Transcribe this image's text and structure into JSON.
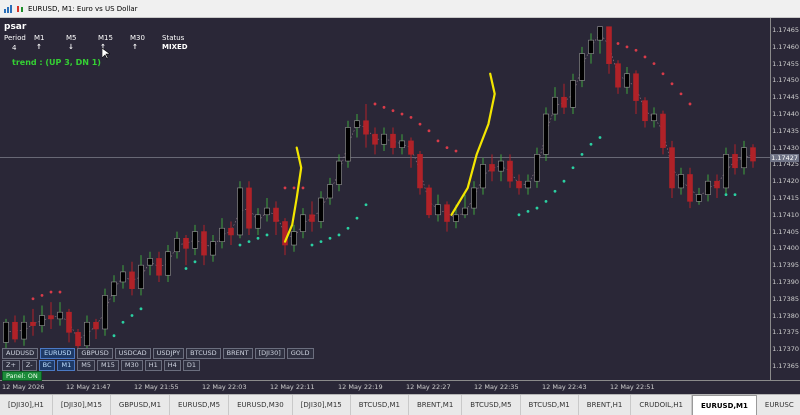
{
  "window": {
    "title": "EURUSD, M1:  Euro vs US Dollar"
  },
  "indicator": {
    "name": "psar",
    "headers": [
      "Period",
      "M1",
      "M5",
      "M15",
      "M30",
      "Status"
    ],
    "period_value": "4",
    "directions": [
      "up",
      "down",
      "up",
      "up"
    ],
    "status": "MIXED",
    "trend": "trend : (UP 3, DN 1)"
  },
  "colors": {
    "background": "#2a2737",
    "bull_candle": "#3ea33e",
    "bear_candle": "#b02228",
    "psar_up": "#2ad1a2",
    "psar_down": "#d93b49",
    "highlight_line": "#f3e600",
    "status": "#ff8c00",
    "trend": "#34d033"
  },
  "price_axis": {
    "labels": [
      "1.17465",
      "1.17460",
      "1.17455",
      "1.17450",
      "1.17445",
      "1.17440",
      "1.17435",
      "1.17430",
      "1.17425",
      "1.17420",
      "1.17415",
      "1.17410",
      "1.17405",
      "1.17400",
      "1.17395",
      "1.17390",
      "1.17385",
      "1.17380",
      "1.17375",
      "1.17370",
      "1.17365"
    ],
    "current_price": "1.17427"
  },
  "time_axis": {
    "labels": [
      "12 May 2026",
      "12 May 21:47",
      "12 May 21:55",
      "12 May 22:03",
      "12 May 22:11",
      "12 May 22:19",
      "12 May 22:27",
      "12 May 22:35",
      "12 May 22:43",
      "12 May 22:51"
    ]
  },
  "symbol_buttons": {
    "row1": [
      "AUDUSD",
      "EURUSD",
      "GBPUSD",
      "USDCAD",
      "USDJPY",
      "BTCUSD",
      "BRENT",
      "[DJI30]",
      "GOLD"
    ],
    "row1_active": "EURUSD",
    "row2": [
      "Z+",
      "Z-",
      "BC",
      "M1",
      "M5",
      "M15",
      "M30",
      "H1",
      "H4",
      "D1"
    ],
    "row2_active": [
      "BC",
      "M1"
    ],
    "panel_toggle": "Panel: ON"
  },
  "bottom_tabs": {
    "items": [
      "[DJI30],H1",
      "[DJI30],M15",
      "GBPUSD,M1",
      "EURUSD,M5",
      "EURUSD,M30",
      "[DJI30],M15",
      "BTCUSD,M1",
      "BRENT,M1",
      "BTCUSD,M5",
      "BTCUSD,M1",
      "BRENT,H1",
      "CRUDOIL,H1",
      "EURUSD,M1",
      "EURUSC"
    ],
    "active": "EURUSD,M1"
  },
  "chart_data": {
    "type": "candlestick",
    "symbol": "EURUSD",
    "timeframe": "M1",
    "ylim": [
      1.17362,
      1.17468
    ],
    "candles": [
      [
        1.17372,
        1.17378,
        1.1737,
        1.17379
      ],
      [
        1.17378,
        1.17373,
        1.17372,
        1.1738
      ],
      [
        1.17373,
        1.17378,
        1.17371,
        1.1738
      ],
      [
        1.17378,
        1.17377,
        1.17374,
        1.17382
      ],
      [
        1.17377,
        1.1738,
        1.17375,
        1.17383
      ],
      [
        1.1738,
        1.17379,
        1.17376,
        1.17384
      ],
      [
        1.17379,
        1.17381,
        1.17377,
        1.17384
      ],
      [
        1.17381,
        1.17375,
        1.17372,
        1.17382
      ],
      [
        1.17375,
        1.17371,
        1.17369,
        1.17376
      ],
      [
        1.17371,
        1.17378,
        1.17369,
        1.1738
      ],
      [
        1.17378,
        1.17376,
        1.17373,
        1.17379
      ],
      [
        1.17376,
        1.17386,
        1.17374,
        1.17388
      ],
      [
        1.17386,
        1.1739,
        1.17384,
        1.17392
      ],
      [
        1.1739,
        1.17393,
        1.17388,
        1.17395
      ],
      [
        1.17393,
        1.17388,
        1.17386,
        1.17396
      ],
      [
        1.17388,
        1.17395,
        1.17386,
        1.17398
      ],
      [
        1.17395,
        1.17397,
        1.17392,
        1.17399
      ],
      [
        1.17397,
        1.17392,
        1.1739,
        1.17399
      ],
      [
        1.17392,
        1.17399,
        1.1739,
        1.17401
      ],
      [
        1.17399,
        1.17403,
        1.17397,
        1.17405
      ],
      [
        1.17403,
        1.174,
        1.17395,
        1.17404
      ],
      [
        1.174,
        1.17405,
        1.17398,
        1.17407
      ],
      [
        1.17405,
        1.17398,
        1.17395,
        1.17407
      ],
      [
        1.17398,
        1.17402,
        1.17396,
        1.17404
      ],
      [
        1.17402,
        1.17406,
        1.174,
        1.17409
      ],
      [
        1.17406,
        1.17404,
        1.17401,
        1.17408
      ],
      [
        1.17404,
        1.17418,
        1.17403,
        1.1742
      ],
      [
        1.17418,
        1.17406,
        1.17404,
        1.1742
      ],
      [
        1.17406,
        1.1741,
        1.17404,
        1.17412
      ],
      [
        1.1741,
        1.17412,
        1.17408,
        1.17415
      ],
      [
        1.17412,
        1.17408,
        1.17404,
        1.17414
      ],
      [
        1.17408,
        1.17401,
        1.17398,
        1.17409
      ],
      [
        1.17401,
        1.17405,
        1.17399,
        1.17407
      ],
      [
        1.17405,
        1.1741,
        1.17403,
        1.17412
      ],
      [
        1.1741,
        1.17408,
        1.17405,
        1.17414
      ],
      [
        1.17408,
        1.17415,
        1.17406,
        1.17417
      ],
      [
        1.17415,
        1.17419,
        1.17413,
        1.17421
      ],
      [
        1.17419,
        1.17426,
        1.17417,
        1.17428
      ],
      [
        1.17426,
        1.17436,
        1.17424,
        1.17438
      ],
      [
        1.17436,
        1.17438,
        1.17433,
        1.1744
      ],
      [
        1.17438,
        1.17434,
        1.1743,
        1.17443
      ],
      [
        1.17434,
        1.17431,
        1.17428,
        1.17436
      ],
      [
        1.17431,
        1.17434,
        1.17429,
        1.17436
      ],
      [
        1.17434,
        1.1743,
        1.17428,
        1.17436
      ],
      [
        1.1743,
        1.17432,
        1.17428,
        1.17434
      ],
      [
        1.17432,
        1.17428,
        1.17424,
        1.17433
      ],
      [
        1.17428,
        1.17418,
        1.17416,
        1.17429
      ],
      [
        1.17418,
        1.1741,
        1.17409,
        1.17419
      ],
      [
        1.1741,
        1.17413,
        1.17408,
        1.17416
      ],
      [
        1.17413,
        1.17408,
        1.17405,
        1.17414
      ],
      [
        1.17408,
        1.1741,
        1.17406,
        1.17413
      ],
      [
        1.1741,
        1.17412,
        1.17409,
        1.17416
      ],
      [
        1.17412,
        1.17418,
        1.1741,
        1.1742
      ],
      [
        1.17418,
        1.17425,
        1.17416,
        1.17427
      ],
      [
        1.17425,
        1.17423,
        1.1742,
        1.17428
      ],
      [
        1.17423,
        1.17426,
        1.1742,
        1.17428
      ],
      [
        1.17426,
        1.1742,
        1.17418,
        1.17428
      ],
      [
        1.1742,
        1.17418,
        1.17416,
        1.17422
      ],
      [
        1.17418,
        1.1742,
        1.17416,
        1.17422
      ],
      [
        1.1742,
        1.17428,
        1.17418,
        1.1743
      ],
      [
        1.17428,
        1.1744,
        1.17426,
        1.17442
      ],
      [
        1.1744,
        1.17445,
        1.17438,
        1.17448
      ],
      [
        1.17445,
        1.17442,
        1.1744,
        1.17449
      ],
      [
        1.17442,
        1.1745,
        1.1744,
        1.17452
      ],
      [
        1.1745,
        1.17458,
        1.17448,
        1.1746
      ],
      [
        1.17458,
        1.17462,
        1.17455,
        1.17464
      ],
      [
        1.17462,
        1.17466,
        1.17458,
        1.17466
      ],
      [
        1.17466,
        1.17455,
        1.17452,
        1.17466
      ],
      [
        1.17455,
        1.17448,
        1.17446,
        1.17456
      ],
      [
        1.17448,
        1.17452,
        1.17446,
        1.17454
      ],
      [
        1.17452,
        1.17444,
        1.1744,
        1.17453
      ],
      [
        1.17444,
        1.17438,
        1.17436,
        1.17445
      ],
      [
        1.17438,
        1.1744,
        1.17436,
        1.17442
      ],
      [
        1.1744,
        1.1743,
        1.17428,
        1.17441
      ],
      [
        1.1743,
        1.17418,
        1.17415,
        1.17432
      ],
      [
        1.17418,
        1.17422,
        1.17416,
        1.17424
      ],
      [
        1.17422,
        1.17414,
        1.17412,
        1.17424
      ],
      [
        1.17414,
        1.17416,
        1.17413,
        1.17418
      ],
      [
        1.17416,
        1.1742,
        1.17414,
        1.17422
      ],
      [
        1.1742,
        1.17418,
        1.17415,
        1.17422
      ],
      [
        1.17418,
        1.17428,
        1.17416,
        1.1743
      ],
      [
        1.17428,
        1.17424,
        1.17422,
        1.17431
      ],
      [
        1.17424,
        1.1743,
        1.17422,
        1.17432
      ],
      [
        1.1743,
        1.17426,
        1.17424,
        1.17431
      ]
    ],
    "psar": [
      {
        "i": 3,
        "v": 1.17385
      },
      {
        "i": 4,
        "v": 1.17386
      },
      {
        "i": 5,
        "v": 1.17387
      },
      {
        "i": 6,
        "v": 1.17387
      },
      {
        "i": 12,
        "v": 1.17374
      },
      {
        "i": 13,
        "v": 1.17378
      },
      {
        "i": 14,
        "v": 1.1738
      },
      {
        "i": 15,
        "v": 1.17382
      },
      {
        "i": 20,
        "v": 1.17394
      },
      {
        "i": 21,
        "v": 1.17396
      },
      {
        "i": 26,
        "v": 1.17401
      },
      {
        "i": 27,
        "v": 1.17402
      },
      {
        "i": 28,
        "v": 1.17403
      },
      {
        "i": 29,
        "v": 1.17404
      },
      {
        "i": 31,
        "v": 1.17418
      },
      {
        "i": 32,
        "v": 1.17418
      },
      {
        "i": 33,
        "v": 1.17418
      },
      {
        "i": 34,
        "v": 1.17401
      },
      {
        "i": 35,
        "v": 1.17402
      },
      {
        "i": 36,
        "v": 1.17403
      },
      {
        "i": 37,
        "v": 1.17404
      },
      {
        "i": 38,
        "v": 1.17406
      },
      {
        "i": 39,
        "v": 1.17409
      },
      {
        "i": 40,
        "v": 1.17413
      },
      {
        "i": 41,
        "v": 1.17443
      },
      {
        "i": 42,
        "v": 1.17442
      },
      {
        "i": 43,
        "v": 1.17441
      },
      {
        "i": 44,
        "v": 1.1744
      },
      {
        "i": 45,
        "v": 1.17439
      },
      {
        "i": 46,
        "v": 1.17437
      },
      {
        "i": 47,
        "v": 1.17435
      },
      {
        "i": 48,
        "v": 1.17432
      },
      {
        "i": 49,
        "v": 1.1743
      },
      {
        "i": 50,
        "v": 1.17429
      },
      {
        "i": 57,
        "v": 1.1741
      },
      {
        "i": 58,
        "v": 1.17411
      },
      {
        "i": 59,
        "v": 1.17412
      },
      {
        "i": 60,
        "v": 1.17414
      },
      {
        "i": 61,
        "v": 1.17417
      },
      {
        "i": 62,
        "v": 1.1742
      },
      {
        "i": 63,
        "v": 1.17424
      },
      {
        "i": 64,
        "v": 1.17428
      },
      {
        "i": 65,
        "v": 1.17431
      },
      {
        "i": 66,
        "v": 1.17433
      },
      {
        "i": 68,
        "v": 1.17461
      },
      {
        "i": 69,
        "v": 1.1746
      },
      {
        "i": 70,
        "v": 1.17459
      },
      {
        "i": 71,
        "v": 1.17457
      },
      {
        "i": 72,
        "v": 1.17455
      },
      {
        "i": 73,
        "v": 1.17452
      },
      {
        "i": 74,
        "v": 1.17449
      },
      {
        "i": 75,
        "v": 1.17446
      },
      {
        "i": 76,
        "v": 1.17443
      },
      {
        "i": 80,
        "v": 1.17416
      },
      {
        "i": 81,
        "v": 1.17416
      }
    ]
  }
}
